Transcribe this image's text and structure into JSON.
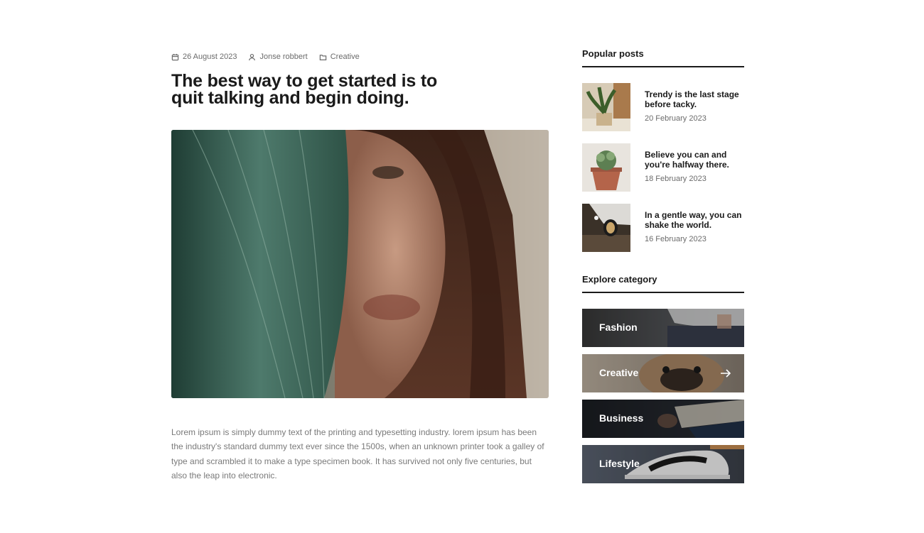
{
  "article": {
    "meta": {
      "date": "26 August 2023",
      "author": "Jonse robbert",
      "category": "Creative"
    },
    "title": "The best way to get started is to quit talking and begin doing.",
    "body": "Lorem ipsum is simply dummy text of the printing and typesetting industry. lorem ipsum has been the industry's standard dummy text ever since the 1500s, when an unknown printer took a galley of type and scrambled it to make a type specimen book. It has survived not only five centuries, but also the leap into electronic."
  },
  "sidebar": {
    "popular_heading": "Popular posts",
    "posts": [
      {
        "title": "Trendy is the last stage before tacky.",
        "date": "20 February 2023"
      },
      {
        "title": "Believe you can and you're halfway there.",
        "date": "18 February 2023"
      },
      {
        "title": "In a gentle way, you can shake the world.",
        "date": "16 February 2023"
      }
    ],
    "category_heading": "Explore category",
    "categories": [
      {
        "label": "Fashion"
      },
      {
        "label": "Creative"
      },
      {
        "label": "Business"
      },
      {
        "label": "Lifestyle"
      }
    ]
  },
  "icons": {
    "date": "calendar-icon",
    "author": "user-icon",
    "category": "folder-icon",
    "category_link": "arrow-right-icon"
  }
}
